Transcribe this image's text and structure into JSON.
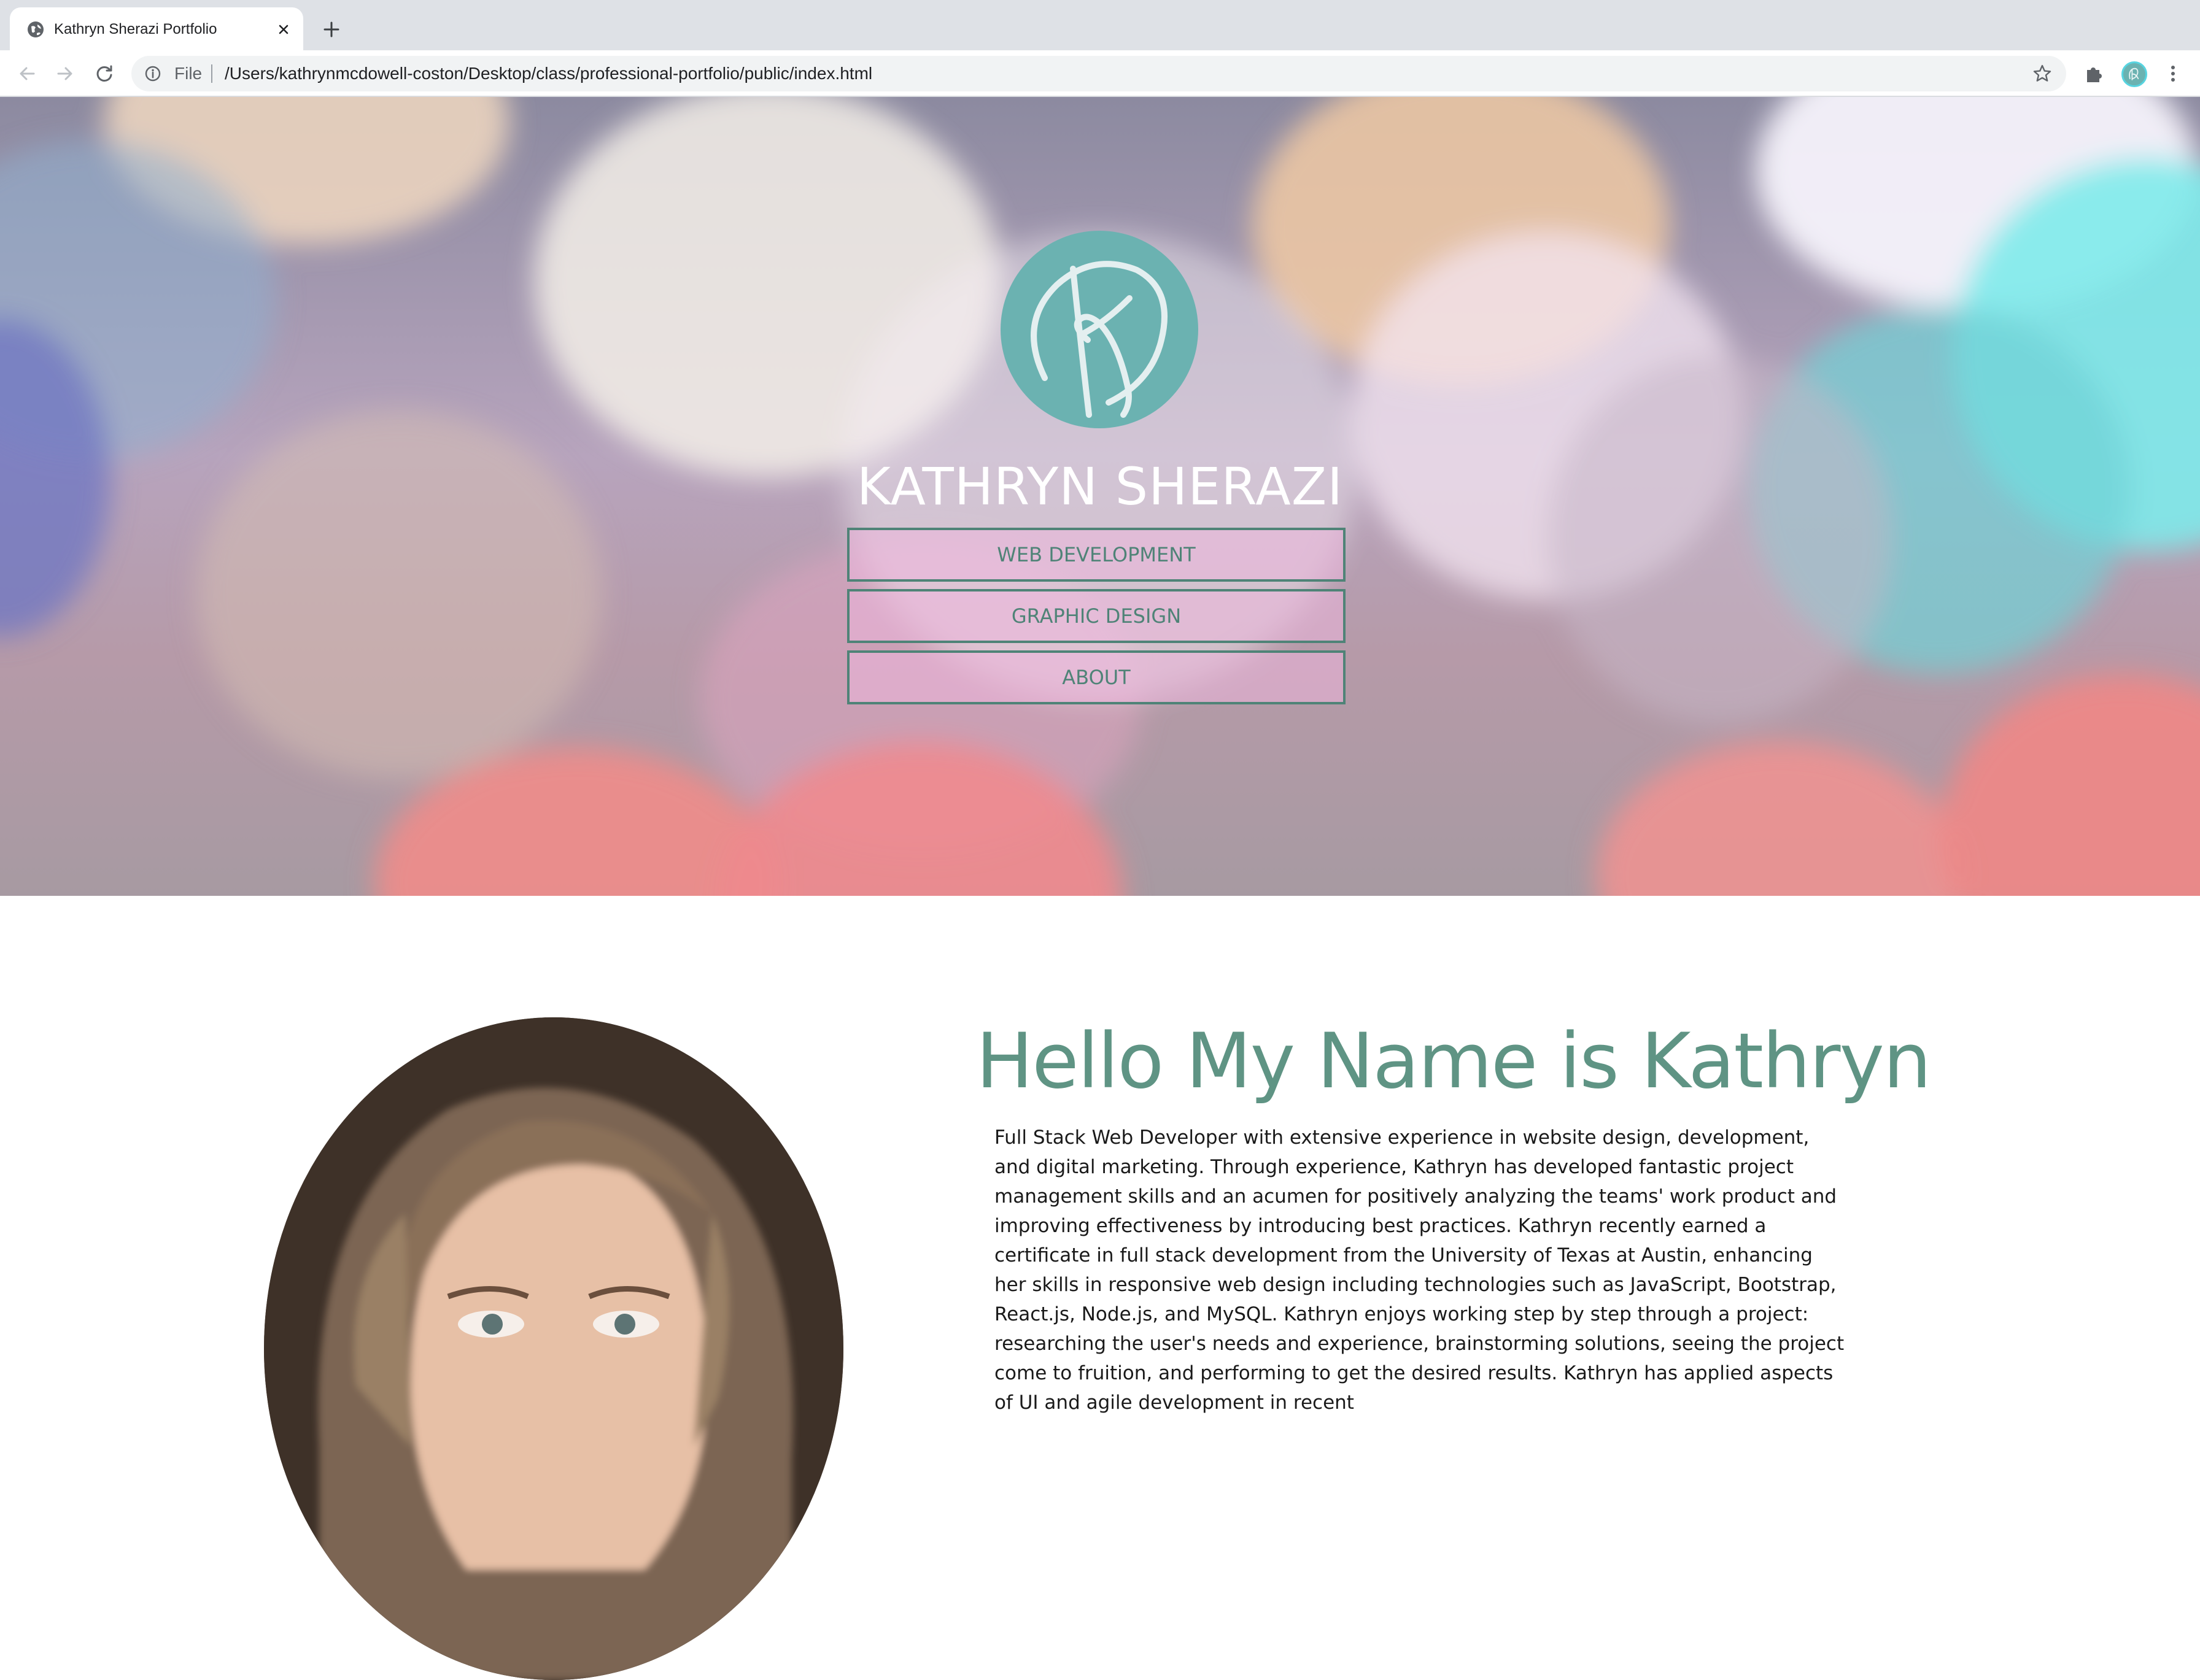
{
  "browser": {
    "tab_title": "Kathryn Sherazi Portfolio",
    "omnibox_scheme": "File",
    "url": "/Users/kathrynmcdowell-coston/Desktop/class/professional-portfolio/public/index.html"
  },
  "hero": {
    "name": "KATHRYN SHERAZI",
    "nav": [
      {
        "label": "WEB DEVELOPMENT"
      },
      {
        "label": "GRAPHIC DESIGN"
      },
      {
        "label": "ABOUT"
      }
    ]
  },
  "about": {
    "heading": "Hello My Name is Kathryn",
    "bio": "Full Stack Web Developer with extensive experience in website design, development, and digital marketing. Through experience, Kathryn has developed fantastic project management skills and an acumen for positively analyzing the teams' work product and improving effectiveness by introducing best practices. Kathryn recently earned a certificate in full stack development from the University of Texas at Austin, enhancing her skills in responsive web design including technologies such as JavaScript, Bootstrap, React.js, Node.js, and MySQL. Kathryn enjoys working step by step through a project: researching the user's needs and experience, brainstorming solutions, seeing the project come to fruition, and performing to get the desired results. Kathryn has applied aspects of UI and agile development in recent"
  },
  "colors": {
    "accent": "#5f9484",
    "button_border": "#4f8377",
    "logo": "#6bb2b1"
  },
  "icons": [
    "globe-icon",
    "close-icon",
    "plus-icon",
    "back-arrow-icon",
    "forward-arrow-icon",
    "reload-icon",
    "info-icon",
    "star-icon",
    "puzzle-icon",
    "kebab-menu-icon"
  ]
}
